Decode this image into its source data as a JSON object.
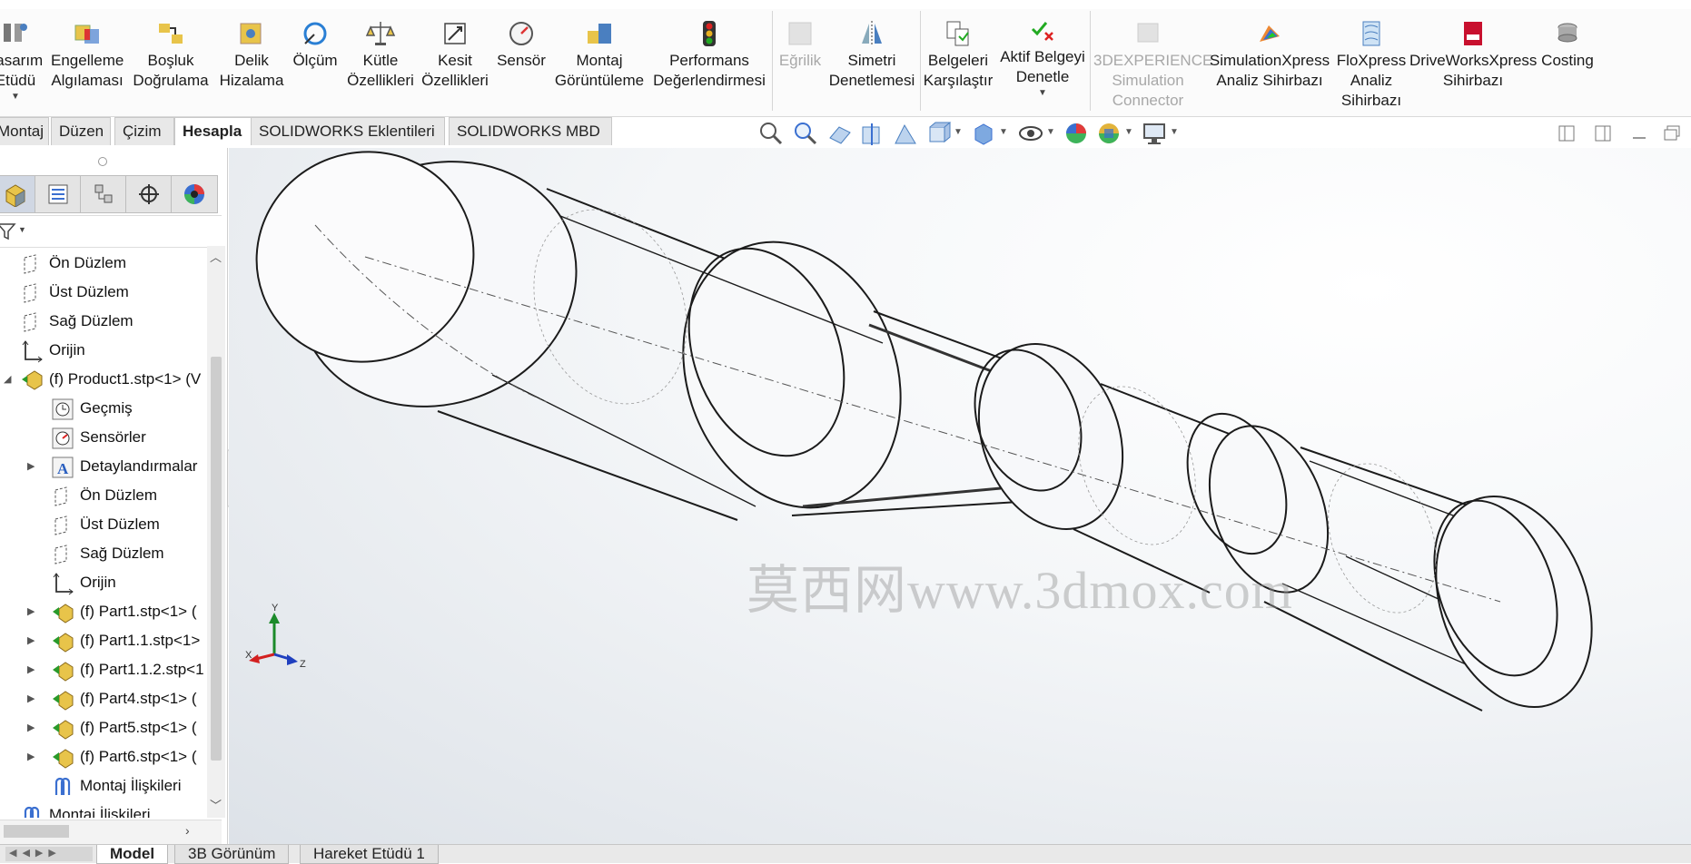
{
  "ribbon": {
    "items": [
      {
        "label": "Tasarım\nEtüdü",
        "icon": "design-study-icon"
      },
      {
        "label": "Engelleme\nAlgılaması",
        "icon": "interference-icon"
      },
      {
        "label": "Boşluk\nDoğrulama",
        "icon": "clearance-icon"
      },
      {
        "label": "Delik\nHizalama",
        "icon": "hole-align-icon"
      },
      {
        "label": "Ölçüm",
        "icon": "measure-icon"
      },
      {
        "label": "Kütle\nÖzellikleri",
        "icon": "mass-props-icon"
      },
      {
        "label": "Kesit\nÖzellikleri",
        "icon": "section-props-icon"
      },
      {
        "label": "Sensör",
        "icon": "sensor-icon"
      },
      {
        "label": "Montaj\nGörüntüleme",
        "icon": "assembly-vis-icon"
      },
      {
        "label": "Performans\nDeğerlendirmesi",
        "icon": "performance-icon"
      },
      {
        "label": "Eğrilik",
        "icon": "curvature-icon"
      },
      {
        "label": "Simetri\nDenetlemesi",
        "icon": "symmetry-icon"
      },
      {
        "label": "Belgeleri\nKarşılaştır",
        "icon": "compare-icon"
      },
      {
        "label": "Aktif Belgeyi\nDenetle",
        "icon": "check-doc-icon"
      },
      {
        "label": "3DEXPERIENCE\nSimulation\nConnector",
        "icon": "3dx-icon"
      },
      {
        "label": "SimulationXpress\nAnaliz Sihirbazı",
        "icon": "simxpress-icon"
      },
      {
        "label": "FloXpress\nAnaliz\nSihirbazı",
        "icon": "floxpress-icon"
      },
      {
        "label": "DriveWorksXpress\nSihirbazı",
        "icon": "driveworks-icon"
      },
      {
        "label": "Costing",
        "icon": "costing-icon"
      }
    ]
  },
  "command_tabs": [
    "Montaj",
    "Düzen",
    "Çizim",
    "Hesapla",
    "SOLIDWORKS Eklentileri",
    "SOLIDWORKS MBD"
  ],
  "tree": {
    "items": [
      {
        "label": "Ön Düzlem",
        "icon": "plane-icon"
      },
      {
        "label": "Üst Düzlem",
        "icon": "plane-icon"
      },
      {
        "label": "Sağ Düzlem",
        "icon": "plane-icon"
      },
      {
        "label": "Orijin",
        "icon": "origin-icon"
      },
      {
        "label": "(f) Product1.stp<1> (V",
        "icon": "assembly-icon"
      },
      {
        "label": "Geçmiş",
        "icon": "history-icon"
      },
      {
        "label": "Sensörler",
        "icon": "sensor-icon"
      },
      {
        "label": "Detaylandırmalar",
        "icon": "annotation-icon"
      },
      {
        "label": "Ön Düzlem",
        "icon": "plane-icon"
      },
      {
        "label": "Üst Düzlem",
        "icon": "plane-icon"
      },
      {
        "label": "Sağ Düzlem",
        "icon": "plane-icon"
      },
      {
        "label": "Orijin",
        "icon": "origin-icon"
      },
      {
        "label": "(f) Part1.stp<1> (",
        "icon": "part-icon"
      },
      {
        "label": "(f) Part1.1.stp<1>",
        "icon": "part-icon"
      },
      {
        "label": "(f) Part1.1.2.stp<1",
        "icon": "part-icon"
      },
      {
        "label": "(f) Part4.stp<1> (",
        "icon": "part-icon"
      },
      {
        "label": "(f) Part5.stp<1> (",
        "icon": "part-icon"
      },
      {
        "label": "(f) Part6.stp<1> (",
        "icon": "part-icon"
      },
      {
        "label": "Montaj İlişkileri",
        "icon": "mates-icon"
      },
      {
        "label": "Montaj İlişkileri",
        "icon": "mates-icon"
      }
    ]
  },
  "bottom_tabs": [
    "Model",
    "3B Görünüm",
    "Hareket Etüdü 1"
  ],
  "triad": {
    "x": "X",
    "y": "Y",
    "z": "Z"
  },
  "watermark": "莫西网www.3dmox.com",
  "colors": {
    "accent": "#c8102e",
    "triad_x": "#d32020",
    "triad_y": "#1b8a2a",
    "triad_z": "#1f3fbf"
  }
}
